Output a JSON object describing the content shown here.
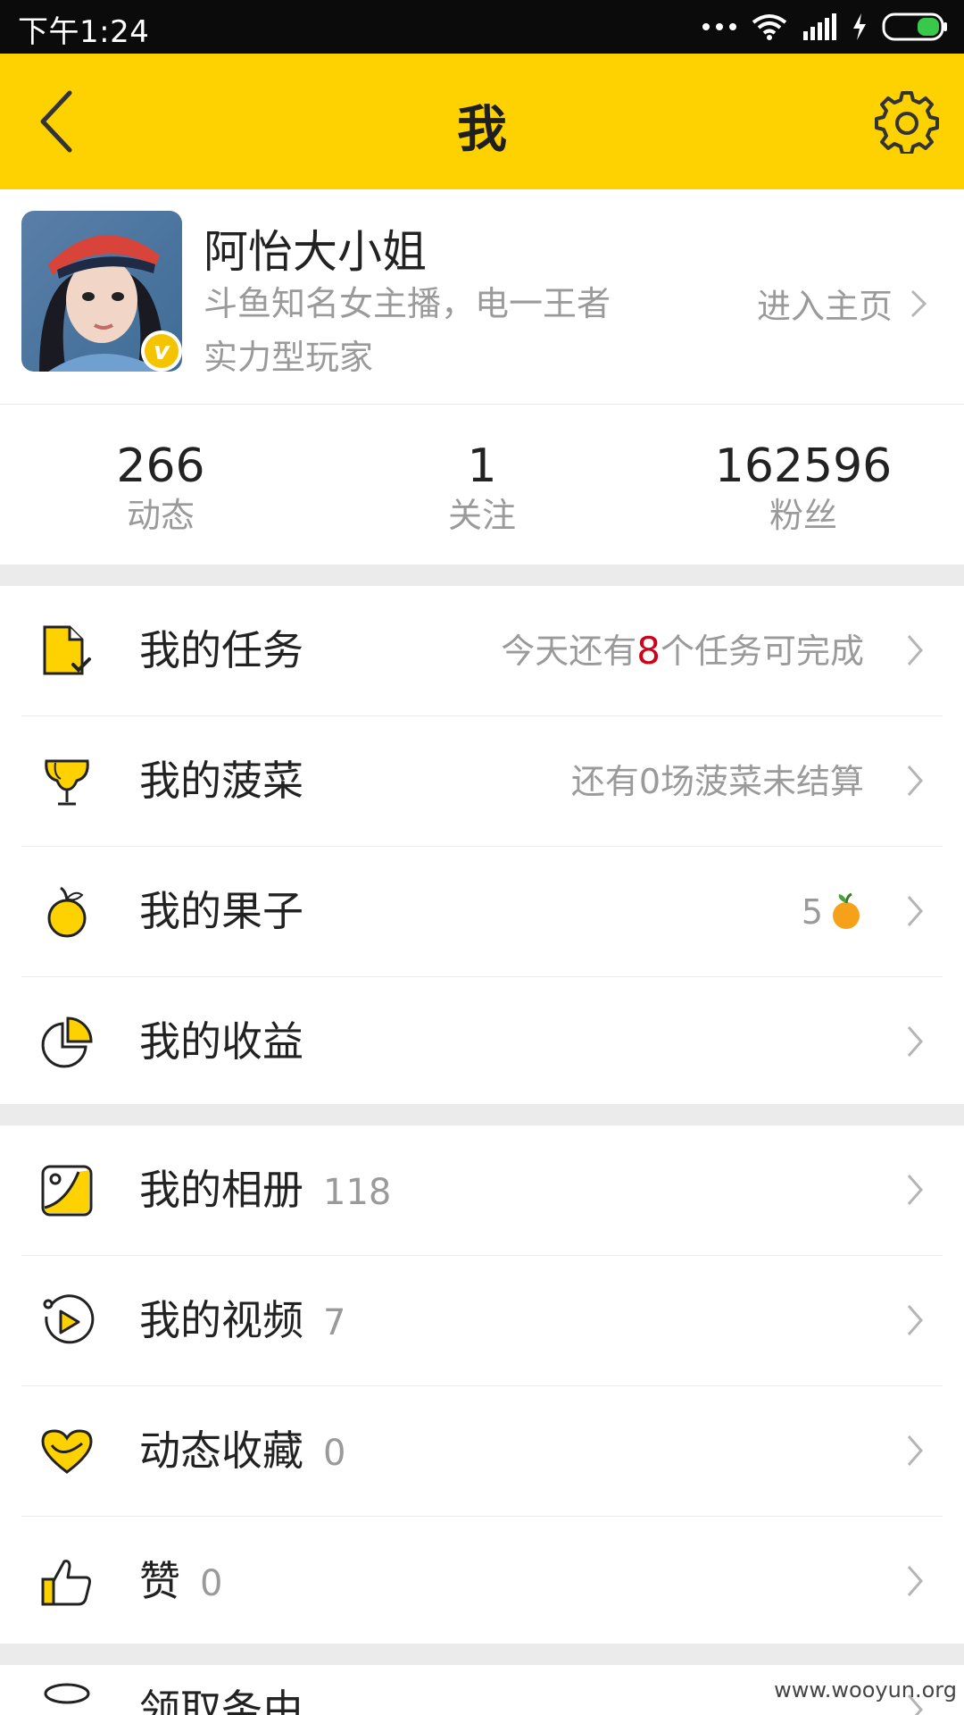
{
  "status_bar": {
    "time": "下午1:24"
  },
  "header": {
    "title": "我"
  },
  "profile": {
    "name": "阿怡大小姐",
    "bio_line1": "斗鱼知名女主播，电一王者",
    "bio_line2": "实力型玩家",
    "home_link": "进入主页",
    "verify_badge": "v"
  },
  "stats": [
    {
      "value": "266",
      "label": "动态"
    },
    {
      "value": "1",
      "label": "关注"
    },
    {
      "value": "162596",
      "label": "粉丝"
    }
  ],
  "menu_group_1": {
    "tasks": {
      "label": "我的任务",
      "hint_pre": "今天还有",
      "hint_num": "8",
      "hint_post": "个任务可完成"
    },
    "bocai": {
      "label": "我的菠菜",
      "hint": "还有0场菠菜未结算"
    },
    "fruit": {
      "label": "我的果子",
      "hint": "5"
    },
    "income": {
      "label": "我的收益"
    }
  },
  "menu_group_2": {
    "album": {
      "label": "我的相册",
      "count": "118"
    },
    "video": {
      "label": "我的视频",
      "count": "7"
    },
    "favorites": {
      "label": "动态收藏",
      "count": "0"
    },
    "likes": {
      "label": "赞",
      "count": "0"
    }
  },
  "partial_next_item": {
    "label": "领取条由"
  },
  "watermark": "www.wooyun.org",
  "colors": {
    "accent": "#fdd200",
    "text_primary": "#222222",
    "text_secondary": "#9a9a9a",
    "highlight_red": "#d0021b"
  }
}
